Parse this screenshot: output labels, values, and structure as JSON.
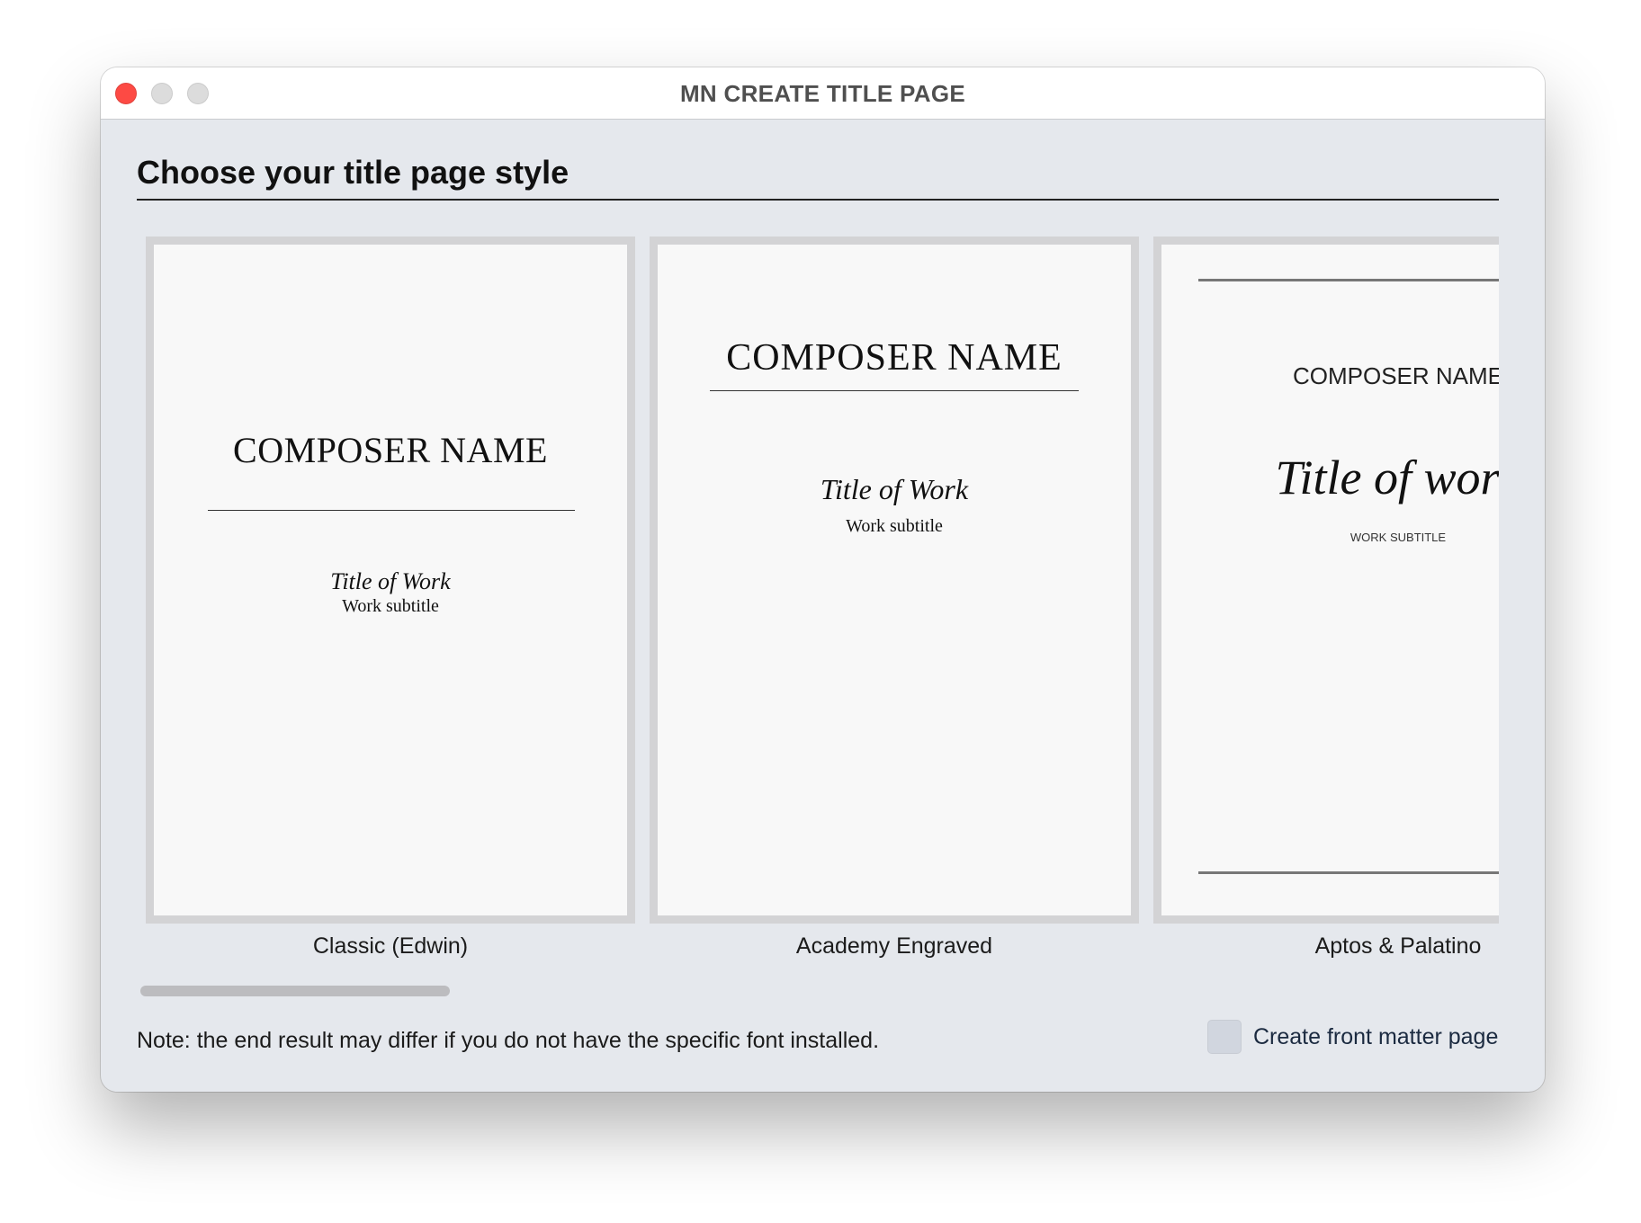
{
  "window": {
    "title": "MN CREATE TITLE PAGE"
  },
  "main": {
    "heading": "Choose your title page style",
    "styles": [
      {
        "label": "Classic (Edwin)",
        "preview": {
          "composer": "COMPOSER NAME",
          "title": "Title of Work",
          "subtitle": "Work subtitle"
        }
      },
      {
        "label": "Academy Engraved",
        "preview": {
          "composer": "COMPOSER NAME",
          "title": "Title of Work",
          "subtitle": "Work subtitle"
        }
      },
      {
        "label": "Aptos & Palatino",
        "preview": {
          "composer": "COMPOSER NAME",
          "title": "Title of work",
          "subtitle": "WORK SUBTITLE"
        }
      }
    ],
    "note": "Note: the end result may differ if you do not have the specific font installed.",
    "front_matter": {
      "label": "Create front matter page",
      "checked": false
    }
  },
  "colors": {
    "close_button": "#fd4a44",
    "window_background": "#e5e8ed",
    "card_border": "#d3d3d5",
    "page_background": "#f8f8f8"
  }
}
